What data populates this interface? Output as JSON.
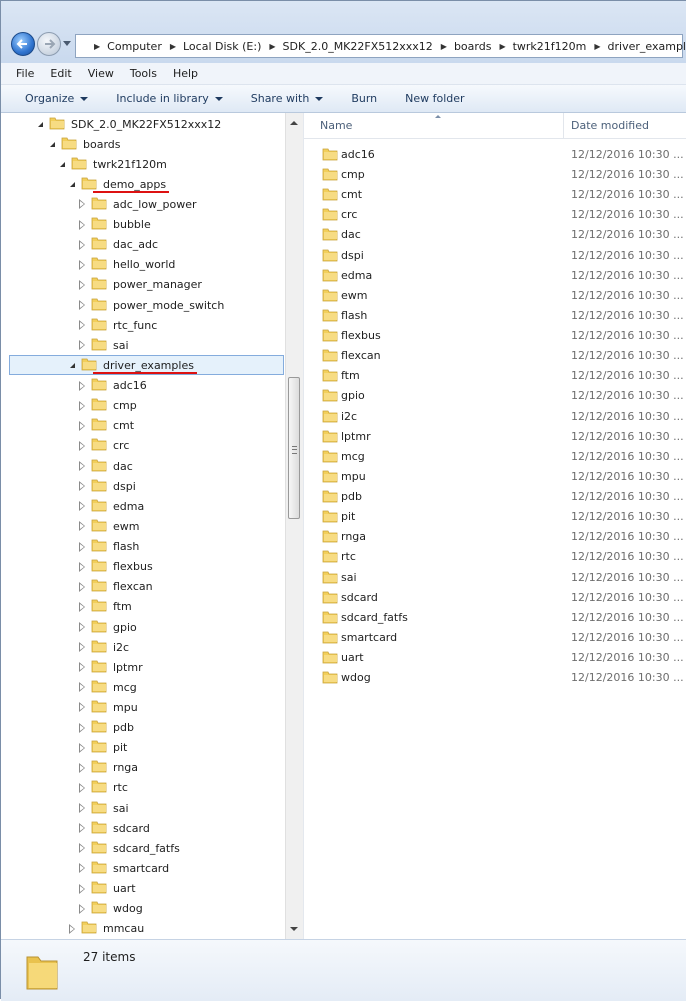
{
  "address_bar": {
    "breadcrumbs": [
      "Computer",
      "Local Disk (E:)",
      "SDK_2.0_MK22FX512xxx12",
      "boards",
      "twrk21f120m",
      "driver_examples"
    ]
  },
  "menu": [
    "File",
    "Edit",
    "View",
    "Tools",
    "Help"
  ],
  "toolbar": {
    "organize": "Organize",
    "include_in_library": "Include in library",
    "share_with": "Share with",
    "burn": "Burn",
    "new_folder": "New folder"
  },
  "nav_tree": [
    {
      "label": "SDK_2.0_MK22FX512xxx12",
      "level": 0,
      "state": "open"
    },
    {
      "label": "boards",
      "level": 1,
      "state": "open"
    },
    {
      "label": "twrk21f120m",
      "level": 2,
      "state": "open"
    },
    {
      "label": "demo_apps",
      "level": 3,
      "state": "open",
      "underlined": true
    },
    {
      "label": "adc_low_power",
      "level": 4,
      "state": "closed"
    },
    {
      "label": "bubble",
      "level": 4,
      "state": "closed"
    },
    {
      "label": "dac_adc",
      "level": 4,
      "state": "closed"
    },
    {
      "label": "hello_world",
      "level": 4,
      "state": "closed"
    },
    {
      "label": "power_manager",
      "level": 4,
      "state": "closed"
    },
    {
      "label": "power_mode_switch",
      "level": 4,
      "state": "closed"
    },
    {
      "label": "rtc_func",
      "level": 4,
      "state": "closed"
    },
    {
      "label": "sai",
      "level": 4,
      "state": "closed"
    },
    {
      "label": "driver_examples",
      "level": 3,
      "state": "open",
      "selected": true,
      "underlined": true
    },
    {
      "label": "adc16",
      "level": 4,
      "state": "closed"
    },
    {
      "label": "cmp",
      "level": 4,
      "state": "closed"
    },
    {
      "label": "cmt",
      "level": 4,
      "state": "closed"
    },
    {
      "label": "crc",
      "level": 4,
      "state": "closed"
    },
    {
      "label": "dac",
      "level": 4,
      "state": "closed"
    },
    {
      "label": "dspi",
      "level": 4,
      "state": "closed"
    },
    {
      "label": "edma",
      "level": 4,
      "state": "closed"
    },
    {
      "label": "ewm",
      "level": 4,
      "state": "closed"
    },
    {
      "label": "flash",
      "level": 4,
      "state": "closed"
    },
    {
      "label": "flexbus",
      "level": 4,
      "state": "closed"
    },
    {
      "label": "flexcan",
      "level": 4,
      "state": "closed"
    },
    {
      "label": "ftm",
      "level": 4,
      "state": "closed"
    },
    {
      "label": "gpio",
      "level": 4,
      "state": "closed"
    },
    {
      "label": "i2c",
      "level": 4,
      "state": "closed"
    },
    {
      "label": "lptmr",
      "level": 4,
      "state": "closed"
    },
    {
      "label": "mcg",
      "level": 4,
      "state": "closed"
    },
    {
      "label": "mpu",
      "level": 4,
      "state": "closed"
    },
    {
      "label": "pdb",
      "level": 4,
      "state": "closed"
    },
    {
      "label": "pit",
      "level": 4,
      "state": "closed"
    },
    {
      "label": "rnga",
      "level": 4,
      "state": "closed"
    },
    {
      "label": "rtc",
      "level": 4,
      "state": "closed"
    },
    {
      "label": "sai",
      "level": 4,
      "state": "closed"
    },
    {
      "label": "sdcard",
      "level": 4,
      "state": "closed"
    },
    {
      "label": "sdcard_fatfs",
      "level": 4,
      "state": "closed"
    },
    {
      "label": "smartcard",
      "level": 4,
      "state": "closed"
    },
    {
      "label": "uart",
      "level": 4,
      "state": "closed"
    },
    {
      "label": "wdog",
      "level": 4,
      "state": "closed"
    },
    {
      "label": "mmcau",
      "level": 3,
      "state": "closed"
    }
  ],
  "columns": {
    "name": "Name",
    "date_modified": "Date modified"
  },
  "files": [
    {
      "name": "adc16",
      "date": "12/12/2016 10:30 ..."
    },
    {
      "name": "cmp",
      "date": "12/12/2016 10:30 ..."
    },
    {
      "name": "cmt",
      "date": "12/12/2016 10:30 ..."
    },
    {
      "name": "crc",
      "date": "12/12/2016 10:30 ..."
    },
    {
      "name": "dac",
      "date": "12/12/2016 10:30 ..."
    },
    {
      "name": "dspi",
      "date": "12/12/2016 10:30 ..."
    },
    {
      "name": "edma",
      "date": "12/12/2016 10:30 ..."
    },
    {
      "name": "ewm",
      "date": "12/12/2016 10:30 ..."
    },
    {
      "name": "flash",
      "date": "12/12/2016 10:30 ..."
    },
    {
      "name": "flexbus",
      "date": "12/12/2016 10:30 ..."
    },
    {
      "name": "flexcan",
      "date": "12/12/2016 10:30 ..."
    },
    {
      "name": "ftm",
      "date": "12/12/2016 10:30 ..."
    },
    {
      "name": "gpio",
      "date": "12/12/2016 10:30 ..."
    },
    {
      "name": "i2c",
      "date": "12/12/2016 10:30 ..."
    },
    {
      "name": "lptmr",
      "date": "12/12/2016 10:30 ..."
    },
    {
      "name": "mcg",
      "date": "12/12/2016 10:30 ..."
    },
    {
      "name": "mpu",
      "date": "12/12/2016 10:30 ..."
    },
    {
      "name": "pdb",
      "date": "12/12/2016 10:30 ..."
    },
    {
      "name": "pit",
      "date": "12/12/2016 10:30 ..."
    },
    {
      "name": "rnga",
      "date": "12/12/2016 10:30 ..."
    },
    {
      "name": "rtc",
      "date": "12/12/2016 10:30 ..."
    },
    {
      "name": "sai",
      "date": "12/12/2016 10:30 ..."
    },
    {
      "name": "sdcard",
      "date": "12/12/2016 10:30 ..."
    },
    {
      "name": "sdcard_fatfs",
      "date": "12/12/2016 10:30 ..."
    },
    {
      "name": "smartcard",
      "date": "12/12/2016 10:30 ..."
    },
    {
      "name": "uart",
      "date": "12/12/2016 10:30 ..."
    },
    {
      "name": "wdog",
      "date": "12/12/2016 10:30 ..."
    }
  ],
  "status": {
    "item_count": "27 items"
  },
  "colors": {
    "selection_fill": "#e5f1fb",
    "selection_border": "#84acdd",
    "annotation_red": "#dd1111",
    "folder_yellow": "#f2cf5b"
  }
}
